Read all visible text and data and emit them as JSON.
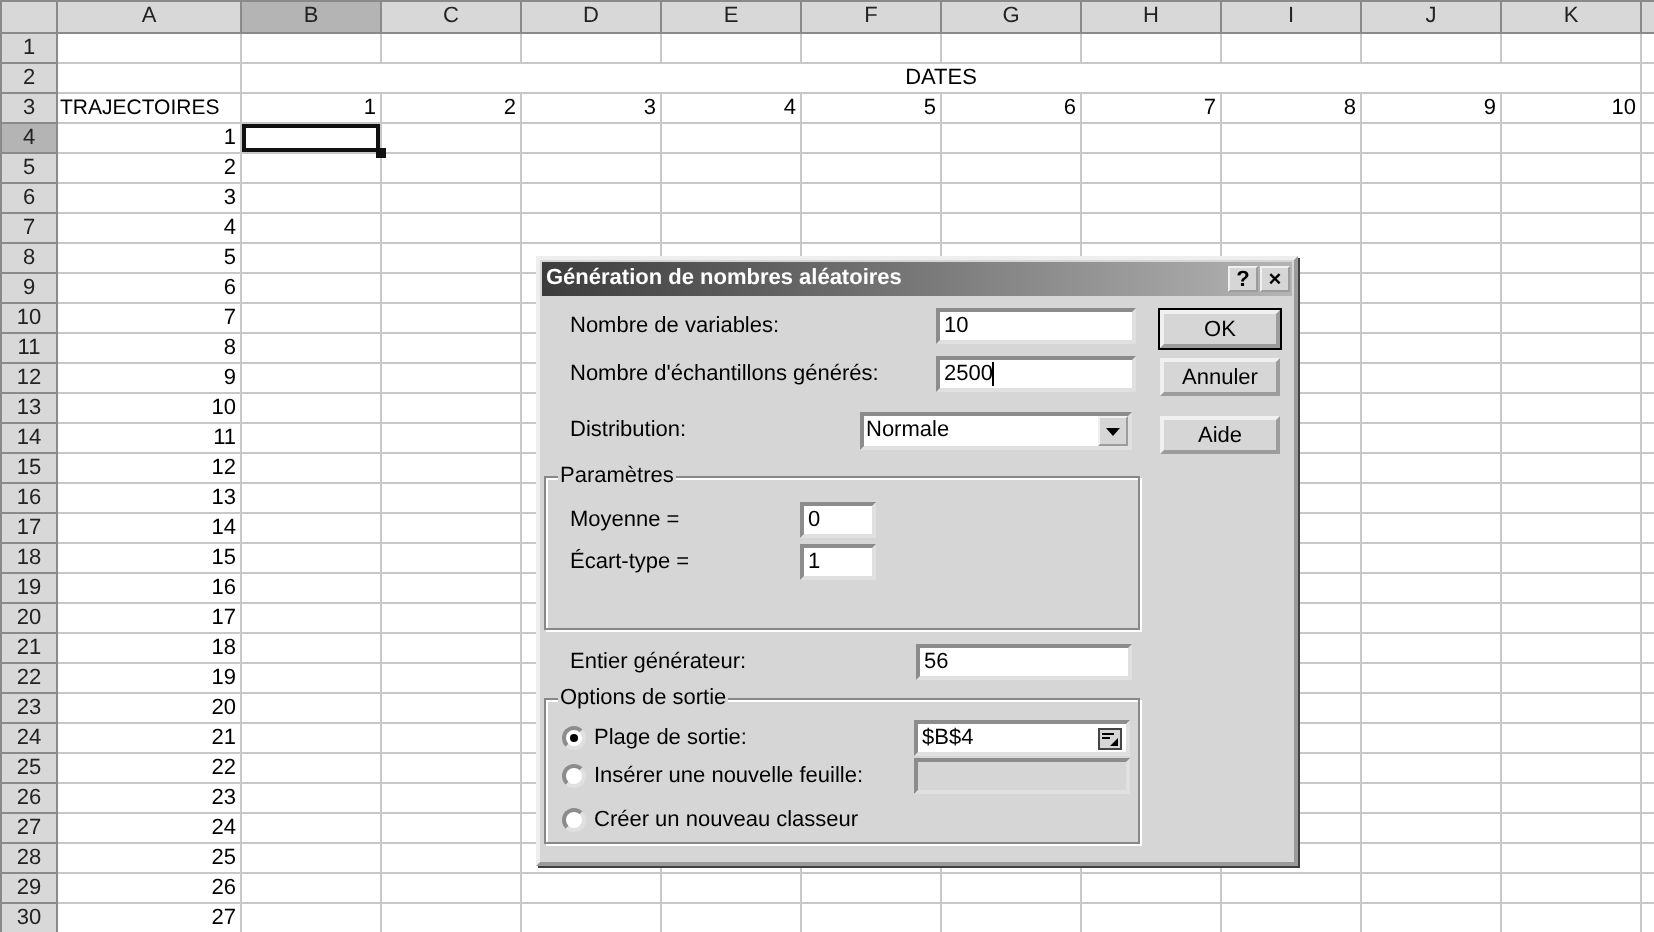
{
  "sheet": {
    "columns": [
      {
        "label": "A",
        "selected": false
      },
      {
        "label": "B",
        "selected": true
      },
      {
        "label": "C",
        "selected": false
      },
      {
        "label": "D",
        "selected": false
      },
      {
        "label": "E",
        "selected": false
      },
      {
        "label": "F",
        "selected": false
      },
      {
        "label": "G",
        "selected": false
      },
      {
        "label": "H",
        "selected": false
      },
      {
        "label": "I",
        "selected": false
      },
      {
        "label": "J",
        "selected": false
      },
      {
        "label": "K",
        "selected": false
      }
    ],
    "rows": [
      {
        "label": "1",
        "selected": false
      },
      {
        "label": "2",
        "selected": false,
        "heading": "DATES"
      },
      {
        "label": "3",
        "selected": false,
        "first": "TRAJECTOIRES",
        "dates": [
          "1",
          "2",
          "3",
          "4",
          "5",
          "6",
          "7",
          "8",
          "9",
          "10"
        ]
      },
      {
        "label": "4",
        "selected": true,
        "first": "1"
      },
      {
        "label": "5",
        "selected": false,
        "first": "2"
      },
      {
        "label": "6",
        "selected": false,
        "first": "3"
      },
      {
        "label": "7",
        "selected": false,
        "first": "4"
      },
      {
        "label": "8",
        "selected": false,
        "first": "5"
      },
      {
        "label": "9",
        "selected": false,
        "first": "6"
      },
      {
        "label": "10",
        "selected": false,
        "first": "7"
      },
      {
        "label": "11",
        "selected": false,
        "first": "8"
      },
      {
        "label": "12",
        "selected": false,
        "first": "9"
      },
      {
        "label": "13",
        "selected": false,
        "first": "10"
      },
      {
        "label": "14",
        "selected": false,
        "first": "11"
      },
      {
        "label": "15",
        "selected": false,
        "first": "12"
      },
      {
        "label": "16",
        "selected": false,
        "first": "13"
      },
      {
        "label": "17",
        "selected": false,
        "first": "14"
      },
      {
        "label": "18",
        "selected": false,
        "first": "15"
      },
      {
        "label": "19",
        "selected": false,
        "first": "16"
      },
      {
        "label": "20",
        "selected": false,
        "first": "17"
      },
      {
        "label": "21",
        "selected": false,
        "first": "18"
      },
      {
        "label": "22",
        "selected": false,
        "first": "19"
      },
      {
        "label": "23",
        "selected": false,
        "first": "20"
      },
      {
        "label": "24",
        "selected": false,
        "first": "21"
      },
      {
        "label": "25",
        "selected": false,
        "first": "22"
      },
      {
        "label": "26",
        "selected": false,
        "first": "23"
      },
      {
        "label": "27",
        "selected": false,
        "first": "24"
      },
      {
        "label": "28",
        "selected": false,
        "first": "25"
      },
      {
        "label": "29",
        "selected": false,
        "first": "26"
      },
      {
        "label": "30",
        "selected": false,
        "first": "27"
      }
    ]
  },
  "dialog": {
    "title": "Génération de nombres aléatoires",
    "help_button": "?",
    "close_button": "×",
    "fields": [
      {
        "label": "Nombre de variables:",
        "value": "10",
        "focused": false
      },
      {
        "label": "Nombre d'échantillons générés:",
        "value": "2500",
        "focused": true
      }
    ],
    "distribution": {
      "label": "Distribution:",
      "value": "Normale"
    },
    "buttons": [
      {
        "label": "OK",
        "default": true
      },
      {
        "label": "Annuler",
        "default": false
      },
      {
        "label": "Aide",
        "default": false
      }
    ],
    "parameters": {
      "title": "Paramètres",
      "fields": [
        {
          "label": "Moyenne =",
          "value": "0"
        },
        {
          "label": "Écart-type =",
          "value": "1"
        }
      ]
    },
    "seed": {
      "label": "Entier générateur:",
      "value": "56"
    },
    "output": {
      "title": "Options de sortie",
      "options": [
        {
          "kind": "range",
          "label": "Plage de sortie:",
          "selected": true,
          "value": "$B$4",
          "disabled": false
        },
        {
          "kind": "field",
          "label": "Insérer une nouvelle feuille:",
          "selected": false,
          "disabled": true
        },
        {
          "kind": "plain",
          "label": "Créer un nouveau classeur",
          "selected": false
        }
      ]
    }
  }
}
